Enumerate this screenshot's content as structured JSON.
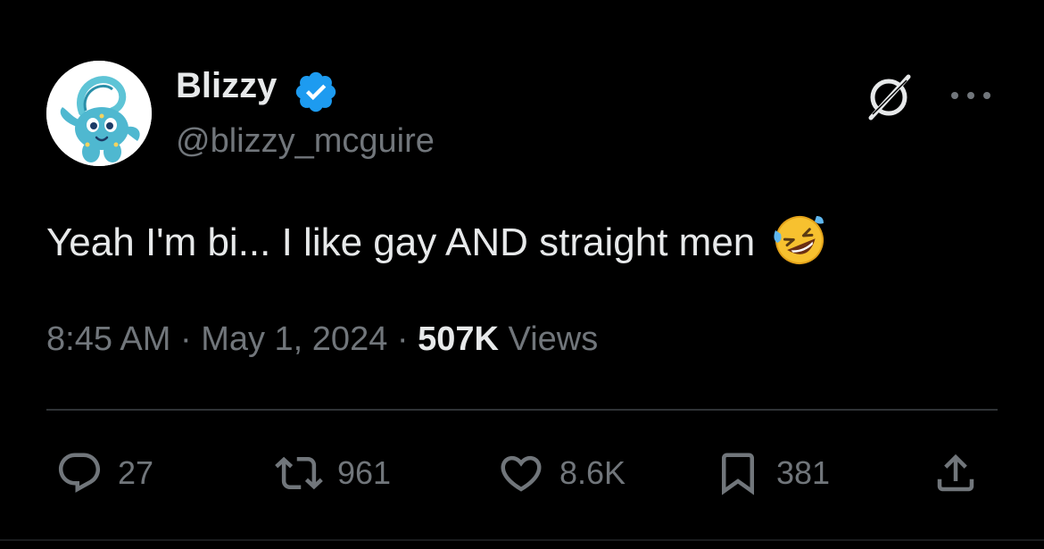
{
  "tweet": {
    "display_name": "Blizzy",
    "handle": "@blizzy_mcguire",
    "verified": true,
    "text": "Yeah I'm bi... I like gay AND straight men",
    "emoji": "rolling-on-the-floor-laughing",
    "time": "8:45 AM",
    "separator": "·",
    "date": "May 1, 2024",
    "views_count": "507K",
    "views_label": "Views"
  },
  "icons": {
    "verified": "verified-badge-icon",
    "grok": "grok-icon",
    "more": "more-icon",
    "reply": "reply-icon",
    "retweet": "retweet-icon",
    "like": "like-icon",
    "bookmark": "bookmark-icon",
    "share": "share-icon"
  },
  "actions": {
    "replies": "27",
    "retweets": "961",
    "likes": "8.6K",
    "bookmarks": "381"
  },
  "colors": {
    "background": "#000000",
    "text_primary": "#e7e9ea",
    "text_secondary": "#71767b",
    "verified_blue": "#1d9bf0",
    "divider": "#2f3336"
  }
}
